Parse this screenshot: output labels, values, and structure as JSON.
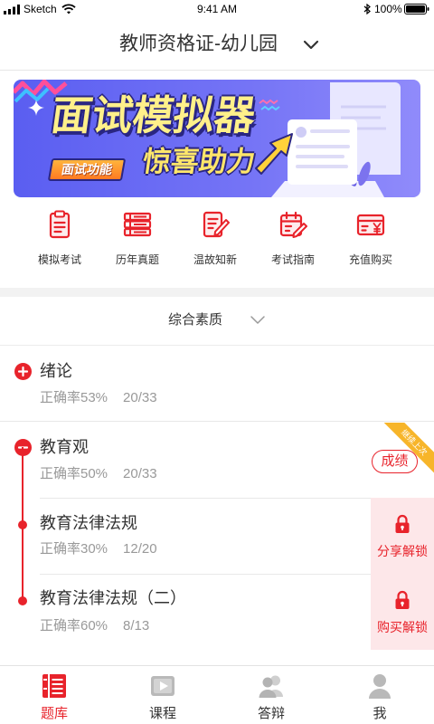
{
  "status_bar": {
    "carrier": "Sketch",
    "time": "9:41 AM",
    "battery": "100%"
  },
  "header": {
    "title": "教师资格证-幼儿园",
    "dropdown_icon": "chevron-down-icon"
  },
  "banner": {
    "headline": "面试模拟器",
    "tag": "面试功能",
    "slogan": "惊喜助力"
  },
  "quick_actions": [
    {
      "label": "模拟考试",
      "icon": "clipboard-icon"
    },
    {
      "label": "历年真题",
      "icon": "book-stack-icon"
    },
    {
      "label": "温故知新",
      "icon": "document-edit-icon"
    },
    {
      "label": "考试指南",
      "icon": "calendar-edit-icon"
    },
    {
      "label": "充值购买",
      "icon": "yuan-card-icon"
    }
  ],
  "subject_filter": {
    "label": "综合素质",
    "icon": "chevron-down-icon"
  },
  "chapters": [
    {
      "title": "绪论",
      "accuracy": "正确率53%",
      "progress": "20/33",
      "expanded": false
    },
    {
      "title": "教育观",
      "accuracy": "正确率50%",
      "progress": "20/33",
      "expanded": true,
      "score_button": "成绩",
      "ribbon": "继续上次",
      "sections": [
        {
          "title": "教育法律法规",
          "accuracy": "正确率30%",
          "progress": "12/20",
          "locked": true,
          "unlock_label": "分享解锁"
        },
        {
          "title": "教育法律法规（二）",
          "accuracy": "正确率60%",
          "progress": "8/13",
          "locked": true,
          "unlock_label": "购买解锁"
        }
      ]
    }
  ],
  "tab_bar": [
    {
      "label": "题库",
      "icon": "question-bank-icon",
      "active": true
    },
    {
      "label": "课程",
      "icon": "video-play-icon",
      "active": false
    },
    {
      "label": "答辩",
      "icon": "people-icon",
      "active": false
    },
    {
      "label": "我",
      "icon": "user-icon",
      "active": false
    }
  ],
  "colors": {
    "accent": "#e8232b",
    "lock_panel": "#fde7e9",
    "ribbon": "#f7b52a",
    "muted_text": "#999999",
    "inactive_icon": "#b9b9b9"
  }
}
